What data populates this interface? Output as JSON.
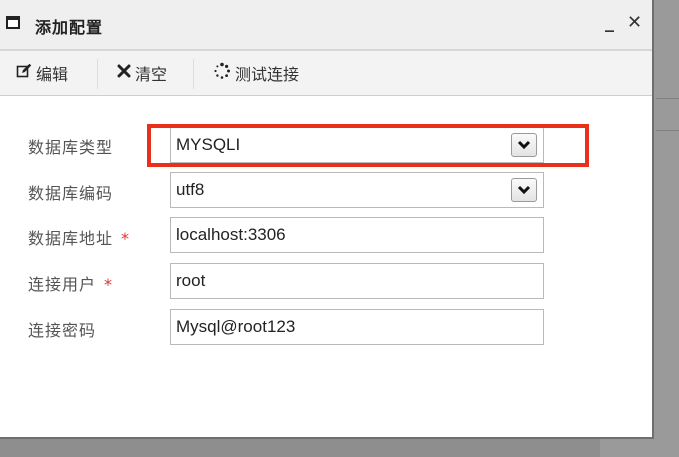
{
  "window": {
    "title": "添加配置",
    "minimize_label": "_",
    "close_label": "✕"
  },
  "toolbar": {
    "edit_label": "编辑",
    "clear_label": "清空",
    "test_label": "测试连接"
  },
  "form": {
    "db_type": {
      "label": "数据库类型",
      "value": "MYSQLI",
      "required": false
    },
    "db_charset": {
      "label": "数据库编码",
      "value": "utf8",
      "required": false
    },
    "db_host": {
      "label": "数据库地址",
      "value": "localhost:3306",
      "required": true
    },
    "db_user": {
      "label": "连接用户",
      "value": "root",
      "required": true
    },
    "db_password": {
      "label": "连接密码",
      "value": "Mysql@root123",
      "required": false
    },
    "required_mark": "*"
  },
  "colors": {
    "highlight": "#e8301c",
    "required": "#e03030"
  }
}
